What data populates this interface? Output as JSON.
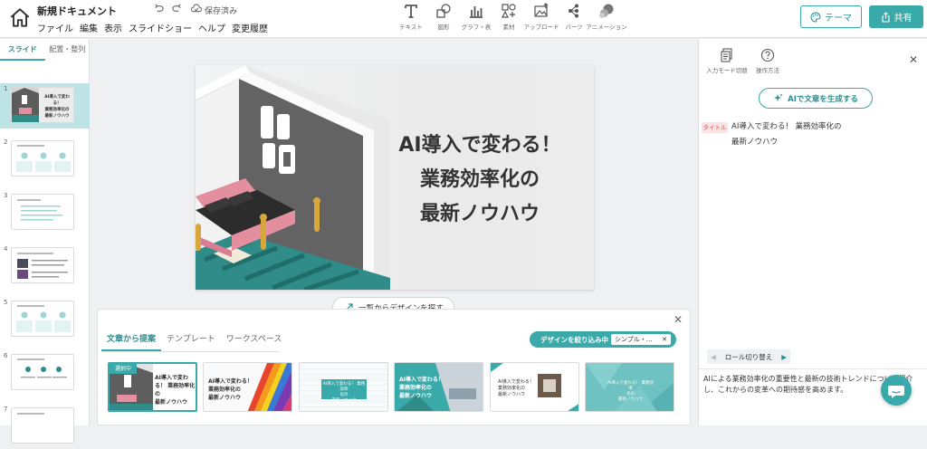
{
  "header": {
    "doc_title": "新規ドキュメント",
    "menu": [
      "ファイル",
      "編集",
      "表示",
      "スライドショー",
      "ヘルプ",
      "変更履歴"
    ],
    "save_status": "保存済み",
    "tools": [
      {
        "label": "テキスト",
        "icon": "text-icon"
      },
      {
        "label": "図形",
        "icon": "shape-icon"
      },
      {
        "label": "グラフ・表",
        "icon": "chart-icon"
      },
      {
        "label": "素材",
        "icon": "material-icon"
      },
      {
        "label": "アップロード",
        "icon": "upload-icon"
      },
      {
        "label": "パーツ",
        "icon": "parts-icon"
      },
      {
        "label": "アニメーション",
        "icon": "animation-icon"
      }
    ],
    "theme_label": "テーマ",
    "share_label": "共有"
  },
  "left_panel": {
    "tabs": [
      "スライド",
      "配置・整列"
    ],
    "slide_numbers": [
      "1",
      "2",
      "3",
      "4",
      "5",
      "6",
      "7"
    ],
    "thumb1_text": "AI導入で変わる！\n業務効率化の\n最新ノウハウ"
  },
  "slide": {
    "title": "AI導入で変わる！\n業務効率化の\n最新ノウハウ"
  },
  "design_panel": {
    "explore_label": "一覧からデザインを探す",
    "tabs": [
      "文章から提案",
      "テンプレート",
      "ワークスペース"
    ],
    "filter_label": "デザインを絞り込み中",
    "filter_chip": "シンプル・…",
    "selected_badge": "選択中",
    "cards": [
      "AI導入で変わ\nる！ 業務効率化\nの\n最新ノウハウ",
      "AI導入で変わる！\n業務効率化の\n最新ノウハウ",
      "AI導入で変わる！ 業務効率\n化の\n最新ノウハウ",
      "AI導入で変わる！\n業務効率化の\n最新ノウハウ",
      "AI導入で変わる！\n業務効率化の\n最新ノウハウ",
      "AI導入で変わる！ 業務効率\n化の\n最新ノウハウ"
    ]
  },
  "right_panel": {
    "input_mode_label": "入力モード切替",
    "help_label": "操作方法",
    "ai_button_label": "AIで文章を生成する",
    "role_badge": "タイトル",
    "outline_text": "AI導入で変わる！ 業務効率化の\n最新ノウハウ",
    "role_switch_label": "ロール切り替え",
    "body_text": "AIによる業務効率化の重要性と最新の技術トレンドについて紹介し、これからの変革への期待感を高めます。"
  },
  "colors": {
    "accent": "#3aa9a9",
    "selected_thumb": "#bde3e4",
    "role_badge_bg": "#fde4e4",
    "role_badge_text": "#d9534f"
  }
}
